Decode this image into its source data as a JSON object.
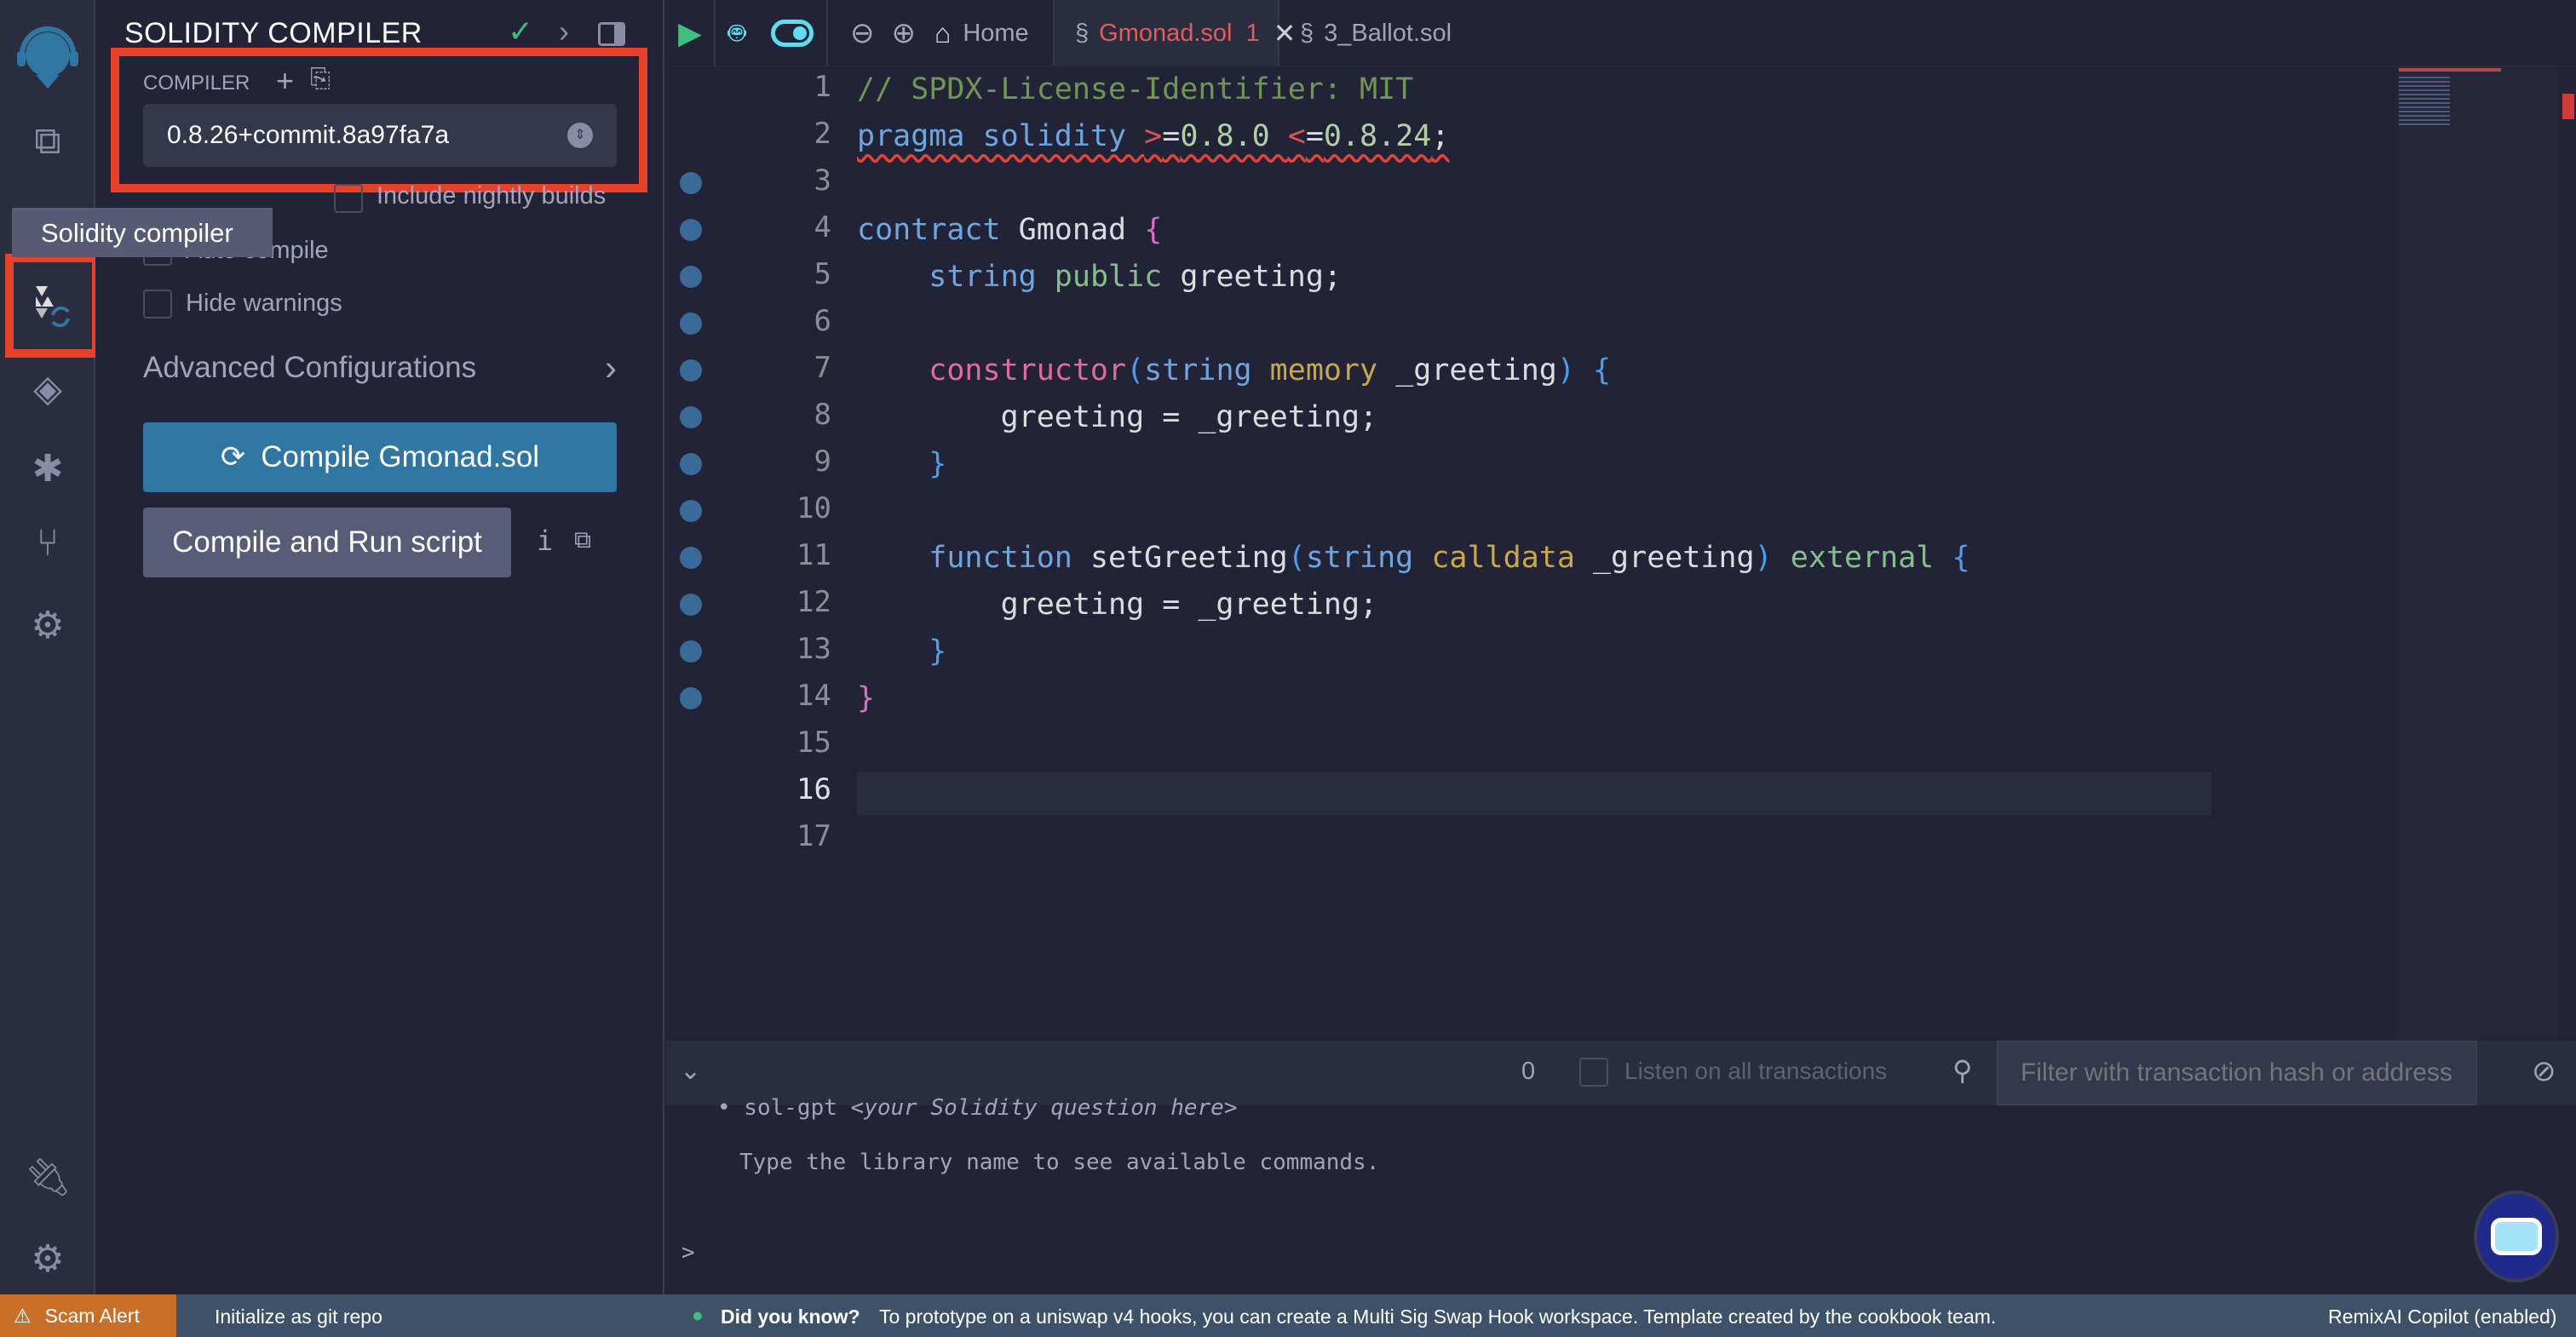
{
  "sidebar_icons": [
    "remix-logo-icon",
    "file-explorer-icon",
    "search-icon",
    "solidity-compiler-icon",
    "deploy-run-icon",
    "debugger-icon",
    "git-icon",
    "settings-plugin-icon",
    "plugin-manager-icon",
    "settings-icon"
  ],
  "tooltip": "Solidity compiler",
  "panel": {
    "title": "SOLIDITY COMPILER",
    "compiler_label": "COMPILER",
    "compiler_version": "0.8.26+commit.8a97fa7a",
    "include_nightly": "Include nightly builds",
    "auto_compile": "Auto compile",
    "hide_warnings": "Hide warnings",
    "advanced": "Advanced Configurations",
    "compile_button": "Compile Gmonad.sol",
    "compile_run_button": "Compile and Run script",
    "info": "i"
  },
  "tabs": {
    "home": "Home",
    "active": "Gmonad.sol",
    "active_errors": "1",
    "other": "3_Ballot.sol"
  },
  "code": [
    [
      [
        "// SPDX-License-Identifier: MIT",
        "cm"
      ]
    ],
    [
      [
        "pragma solidity ",
        "k squig"
      ],
      [
        ">",
        "op squig"
      ],
      [
        "=",
        "w squig"
      ],
      [
        "0.8.0 ",
        "n squig"
      ],
      [
        "<",
        "op squig"
      ],
      [
        "=",
        "w squig"
      ],
      [
        "0.8.24",
        "n squig"
      ],
      [
        ";",
        "w squig"
      ]
    ],
    [],
    [
      [
        "contract ",
        "k"
      ],
      [
        "Gmonad ",
        "w"
      ],
      [
        "{",
        "p"
      ]
    ],
    [
      [
        "    string ",
        "k"
      ],
      [
        "public ",
        "g"
      ],
      [
        "greeting;",
        "w"
      ]
    ],
    [],
    [
      [
        "    constructor",
        "cs"
      ],
      [
        "(",
        "b"
      ],
      [
        "string ",
        "k"
      ],
      [
        "memory ",
        "y"
      ],
      [
        "_greeting",
        "w"
      ],
      [
        ") ",
        "b"
      ],
      [
        "{",
        "b"
      ]
    ],
    [
      [
        "        greeting = _greeting;",
        "w"
      ]
    ],
    [
      [
        "    }",
        "b"
      ]
    ],
    [],
    [
      [
        "    function ",
        "k"
      ],
      [
        "setGreeting",
        "w"
      ],
      [
        "(",
        "b"
      ],
      [
        "string ",
        "k"
      ],
      [
        "calldata ",
        "y"
      ],
      [
        "_greeting",
        "w"
      ],
      [
        ") ",
        "b"
      ],
      [
        "external ",
        "g"
      ],
      [
        "{",
        "b"
      ]
    ],
    [
      [
        "        greeting = _greeting;",
        "w"
      ]
    ],
    [
      [
        "    }",
        "b"
      ]
    ],
    [
      [
        "}",
        "p"
      ]
    ],
    [],
    [],
    []
  ],
  "breakpoint_lines": [
    3,
    4,
    5,
    6,
    7,
    8,
    9,
    10,
    11,
    12,
    13,
    14
  ],
  "current_line": 16,
  "terminal": {
    "tx_count": "0",
    "listen_label": "Listen on all transactions",
    "filter_placeholder": "Filter with transaction hash or address",
    "line1_prefix": "• sol-gpt ",
    "line1_italic": "<your Solidity question here>",
    "line2": "Type the library name to see available commands.",
    "prompt": ">"
  },
  "status": {
    "scam": "Scam Alert",
    "git": "Initialize as git repo",
    "tip_title": "Did you know?",
    "tip": "To prototype on a uniswap v4 hooks, you can create a Multi Sig Swap Hook workspace. Template created by the cookbook team.",
    "copilot": "RemixAI Copilot (enabled)"
  },
  "colors": {
    "accent": "#2f76a2",
    "highlight": "#e8412a",
    "status_bar": "#3d5268",
    "scam": "#c8702a"
  }
}
